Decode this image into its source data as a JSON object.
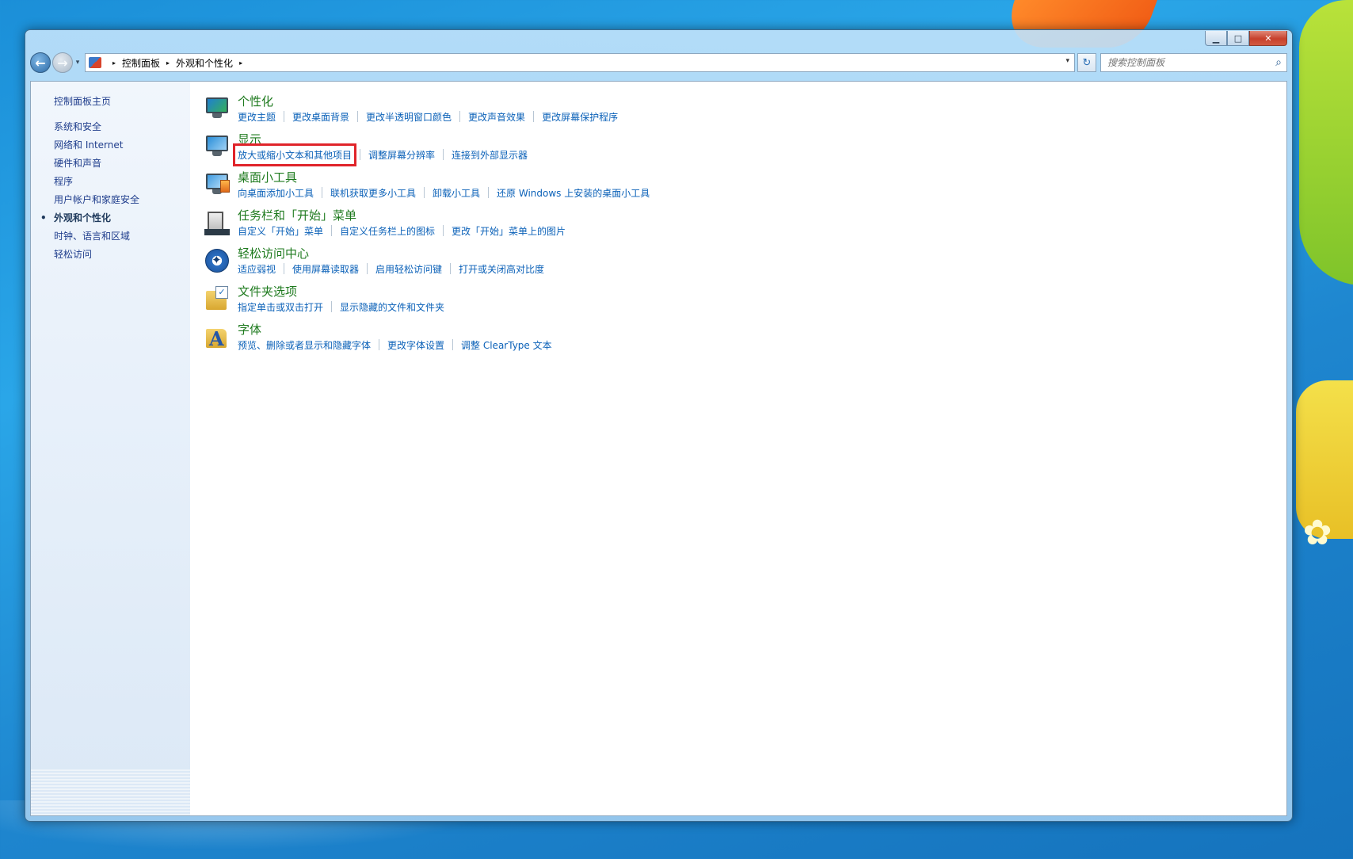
{
  "desktop": {},
  "window": {
    "caption_buttons": {
      "minimize": "▁",
      "maximize": "□",
      "close": "✕"
    },
    "nav": {
      "back_glyph": "←",
      "forward_glyph": "→",
      "history_glyph": "▾",
      "breadcrumbs": [
        "控制面板",
        "外观和个性化"
      ],
      "crumb_separator": "▸",
      "address_dropdown_glyph": "▾",
      "refresh_glyph": "↻",
      "search_placeholder": "搜索控制面板",
      "search_glyph": "⌕"
    },
    "sidebar": {
      "home": "控制面板主页",
      "items": [
        {
          "label": "系统和安全"
        },
        {
          "label": "网络和 Internet"
        },
        {
          "label": "硬件和声音"
        },
        {
          "label": "程序"
        },
        {
          "label": "用户帐户和家庭安全"
        },
        {
          "label": "外观和个性化",
          "current": true
        },
        {
          "label": "时钟、语言和区域"
        },
        {
          "label": "轻松访问"
        }
      ],
      "bullet": "•"
    },
    "categories": [
      {
        "title": "个性化",
        "icon": "personalization-icon",
        "links": [
          "更改主题",
          "更改桌面背景",
          "更改半透明窗口颜色",
          "更改声音效果",
          "更改屏幕保护程序"
        ]
      },
      {
        "title": "显示",
        "icon": "display-icon",
        "links": [
          "放大或缩小文本和其他项目",
          "调整屏幕分辨率",
          "连接到外部显示器"
        ]
      },
      {
        "title": "桌面小工具",
        "icon": "gadgets-icon",
        "links": [
          "向桌面添加小工具",
          "联机获取更多小工具",
          "卸载小工具",
          "还原 Windows 上安装的桌面小工具"
        ]
      },
      {
        "title": "任务栏和「开始」菜单",
        "icon": "taskbar-icon",
        "links": [
          "自定义「开始」菜单",
          "自定义任务栏上的图标",
          "更改「开始」菜单上的图片"
        ]
      },
      {
        "title": "轻松访问中心",
        "icon": "ease-of-access-icon",
        "links": [
          "适应弱视",
          "使用屏幕读取器",
          "启用轻松访问键",
          "打开或关闭高对比度"
        ]
      },
      {
        "title": "文件夹选项",
        "icon": "folder-options-icon",
        "links": [
          "指定单击或双击打开",
          "显示隐藏的文件和文件夹"
        ]
      },
      {
        "title": "字体",
        "icon": "fonts-icon",
        "links": [
          "预览、删除或者显示和隐藏字体",
          "更改字体设置",
          "调整 ClearType 文本"
        ]
      }
    ],
    "check_glyph": "✓",
    "font_glyph": "A",
    "highlight_color": "#e0242a"
  }
}
